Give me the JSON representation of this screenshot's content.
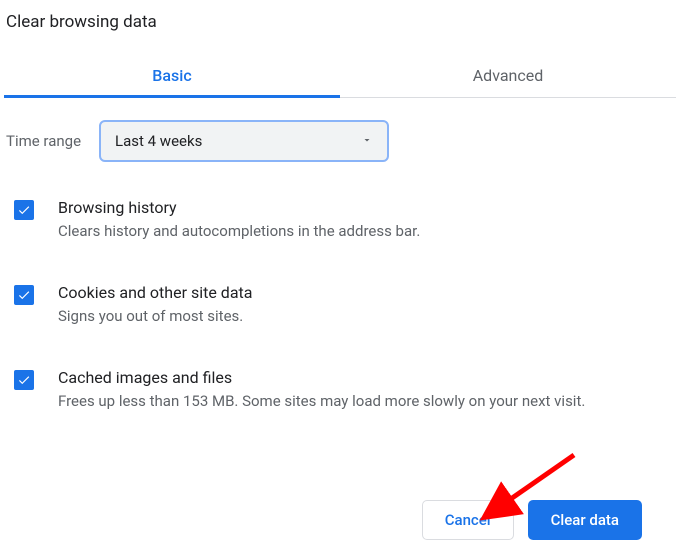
{
  "dialog": {
    "title": "Clear browsing data",
    "tabs": {
      "basic": "Basic",
      "advanced": "Advanced"
    },
    "time_range": {
      "label": "Time range",
      "selected": "Last 4 weeks"
    },
    "options": {
      "browsing_history": {
        "title": "Browsing history",
        "desc": "Clears history and autocompletions in the address bar.",
        "checked": true
      },
      "cookies": {
        "title": "Cookies and other site data",
        "desc": "Signs you out of most sites.",
        "checked": true
      },
      "cache": {
        "title": "Cached images and files",
        "desc": "Frees up less than 153 MB. Some sites may load more slowly on your next visit.",
        "checked": true
      }
    },
    "buttons": {
      "cancel": "Cancel",
      "clear": "Clear data"
    }
  }
}
